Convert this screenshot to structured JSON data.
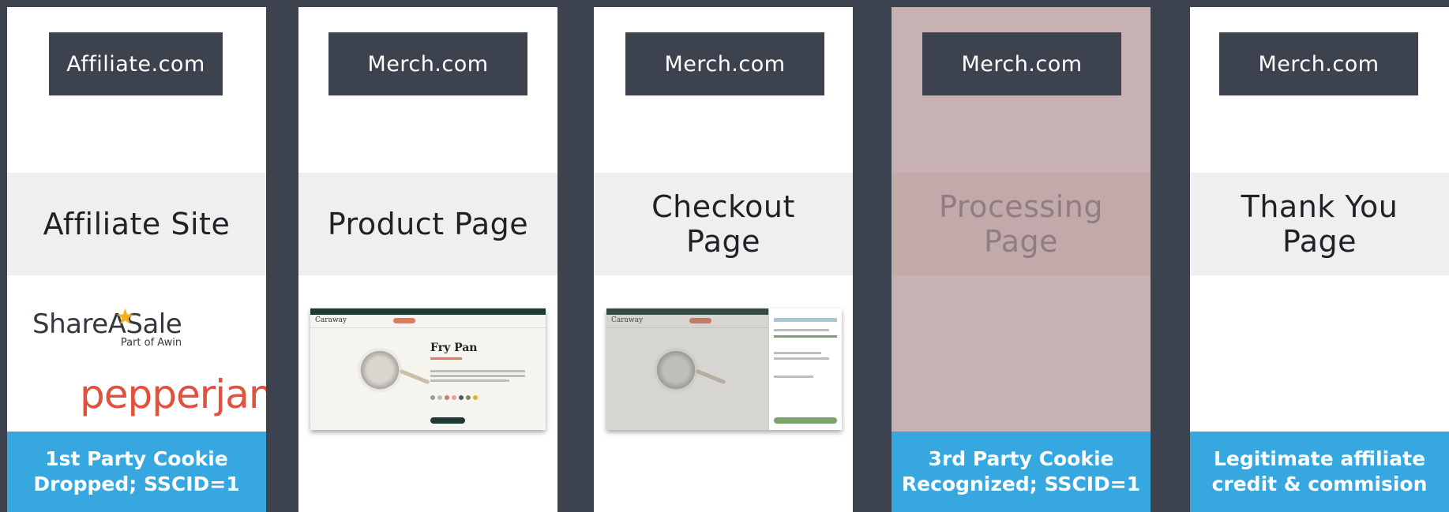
{
  "columns": [
    {
      "site": "Affiliate.com",
      "page": "Affiliate Site",
      "footer": "1st Party Cookie\nDropped; SSCID=1",
      "logos": {
        "shareasale": "ShareASale",
        "shareasale_sub": "Part of Awin",
        "pepperjam": "pepperjam"
      }
    },
    {
      "site": "Merch.com",
      "page": "Product Page",
      "screenshot": {
        "brand": "Caraway",
        "product_title": "Fry Pan"
      }
    },
    {
      "site": "Merch.com",
      "page": "Checkout\nPage",
      "screenshot": {
        "brand": "Caraway"
      }
    },
    {
      "site": "Merch.com",
      "page": "Processing\nPage",
      "footer": "3rd Party Cookie\nRecognized; SSCID=1"
    },
    {
      "site": "Merch.com",
      "page": "Thank You\nPage",
      "footer": "Legitimate affiliate\ncredit & commision"
    }
  ],
  "colors": {
    "background": "#3d434e",
    "site_box": "#3d434e",
    "band": "#efefef",
    "footer": "#36a7df",
    "processing_column": "#c7b1b2",
    "pepperjam": "#e0523c",
    "star": "#f3b11f"
  },
  "icons": [
    "star-icon",
    "pan-image"
  ]
}
